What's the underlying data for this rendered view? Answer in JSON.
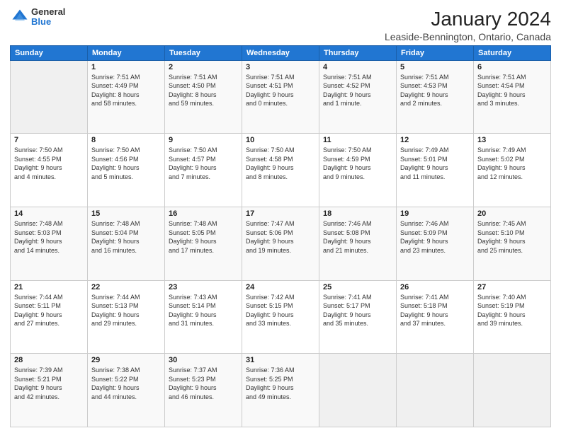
{
  "logo": {
    "general": "General",
    "blue": "Blue"
  },
  "header": {
    "title": "January 2024",
    "subtitle": "Leaside-Bennington, Ontario, Canada"
  },
  "weekdays": [
    "Sunday",
    "Monday",
    "Tuesday",
    "Wednesday",
    "Thursday",
    "Friday",
    "Saturday"
  ],
  "weeks": [
    [
      {
        "day": "",
        "info": ""
      },
      {
        "day": "1",
        "info": "Sunrise: 7:51 AM\nSunset: 4:49 PM\nDaylight: 8 hours\nand 58 minutes."
      },
      {
        "day": "2",
        "info": "Sunrise: 7:51 AM\nSunset: 4:50 PM\nDaylight: 8 hours\nand 59 minutes."
      },
      {
        "day": "3",
        "info": "Sunrise: 7:51 AM\nSunset: 4:51 PM\nDaylight: 9 hours\nand 0 minutes."
      },
      {
        "day": "4",
        "info": "Sunrise: 7:51 AM\nSunset: 4:52 PM\nDaylight: 9 hours\nand 1 minute."
      },
      {
        "day": "5",
        "info": "Sunrise: 7:51 AM\nSunset: 4:53 PM\nDaylight: 9 hours\nand 2 minutes."
      },
      {
        "day": "6",
        "info": "Sunrise: 7:51 AM\nSunset: 4:54 PM\nDaylight: 9 hours\nand 3 minutes."
      }
    ],
    [
      {
        "day": "7",
        "info": "Sunrise: 7:50 AM\nSunset: 4:55 PM\nDaylight: 9 hours\nand 4 minutes."
      },
      {
        "day": "8",
        "info": "Sunrise: 7:50 AM\nSunset: 4:56 PM\nDaylight: 9 hours\nand 5 minutes."
      },
      {
        "day": "9",
        "info": "Sunrise: 7:50 AM\nSunset: 4:57 PM\nDaylight: 9 hours\nand 7 minutes."
      },
      {
        "day": "10",
        "info": "Sunrise: 7:50 AM\nSunset: 4:58 PM\nDaylight: 9 hours\nand 8 minutes."
      },
      {
        "day": "11",
        "info": "Sunrise: 7:50 AM\nSunset: 4:59 PM\nDaylight: 9 hours\nand 9 minutes."
      },
      {
        "day": "12",
        "info": "Sunrise: 7:49 AM\nSunset: 5:01 PM\nDaylight: 9 hours\nand 11 minutes."
      },
      {
        "day": "13",
        "info": "Sunrise: 7:49 AM\nSunset: 5:02 PM\nDaylight: 9 hours\nand 12 minutes."
      }
    ],
    [
      {
        "day": "14",
        "info": "Sunrise: 7:48 AM\nSunset: 5:03 PM\nDaylight: 9 hours\nand 14 minutes."
      },
      {
        "day": "15",
        "info": "Sunrise: 7:48 AM\nSunset: 5:04 PM\nDaylight: 9 hours\nand 16 minutes."
      },
      {
        "day": "16",
        "info": "Sunrise: 7:48 AM\nSunset: 5:05 PM\nDaylight: 9 hours\nand 17 minutes."
      },
      {
        "day": "17",
        "info": "Sunrise: 7:47 AM\nSunset: 5:06 PM\nDaylight: 9 hours\nand 19 minutes."
      },
      {
        "day": "18",
        "info": "Sunrise: 7:46 AM\nSunset: 5:08 PM\nDaylight: 9 hours\nand 21 minutes."
      },
      {
        "day": "19",
        "info": "Sunrise: 7:46 AM\nSunset: 5:09 PM\nDaylight: 9 hours\nand 23 minutes."
      },
      {
        "day": "20",
        "info": "Sunrise: 7:45 AM\nSunset: 5:10 PM\nDaylight: 9 hours\nand 25 minutes."
      }
    ],
    [
      {
        "day": "21",
        "info": "Sunrise: 7:44 AM\nSunset: 5:11 PM\nDaylight: 9 hours\nand 27 minutes."
      },
      {
        "day": "22",
        "info": "Sunrise: 7:44 AM\nSunset: 5:13 PM\nDaylight: 9 hours\nand 29 minutes."
      },
      {
        "day": "23",
        "info": "Sunrise: 7:43 AM\nSunset: 5:14 PM\nDaylight: 9 hours\nand 31 minutes."
      },
      {
        "day": "24",
        "info": "Sunrise: 7:42 AM\nSunset: 5:15 PM\nDaylight: 9 hours\nand 33 minutes."
      },
      {
        "day": "25",
        "info": "Sunrise: 7:41 AM\nSunset: 5:17 PM\nDaylight: 9 hours\nand 35 minutes."
      },
      {
        "day": "26",
        "info": "Sunrise: 7:41 AM\nSunset: 5:18 PM\nDaylight: 9 hours\nand 37 minutes."
      },
      {
        "day": "27",
        "info": "Sunrise: 7:40 AM\nSunset: 5:19 PM\nDaylight: 9 hours\nand 39 minutes."
      }
    ],
    [
      {
        "day": "28",
        "info": "Sunrise: 7:39 AM\nSunset: 5:21 PM\nDaylight: 9 hours\nand 42 minutes."
      },
      {
        "day": "29",
        "info": "Sunrise: 7:38 AM\nSunset: 5:22 PM\nDaylight: 9 hours\nand 44 minutes."
      },
      {
        "day": "30",
        "info": "Sunrise: 7:37 AM\nSunset: 5:23 PM\nDaylight: 9 hours\nand 46 minutes."
      },
      {
        "day": "31",
        "info": "Sunrise: 7:36 AM\nSunset: 5:25 PM\nDaylight: 9 hours\nand 49 minutes."
      },
      {
        "day": "",
        "info": ""
      },
      {
        "day": "",
        "info": ""
      },
      {
        "day": "",
        "info": ""
      }
    ]
  ]
}
